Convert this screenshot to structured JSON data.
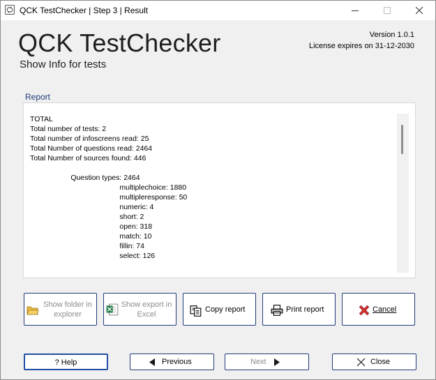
{
  "window": {
    "title": "QCK TestChecker | Step 3 | Result"
  },
  "header": {
    "app_title": "QCK TestChecker",
    "subtitle": "Show Info for tests",
    "version": "Version 1.0.1",
    "license": "License expires on 31-12-2030"
  },
  "report": {
    "label": "Report",
    "lines": [
      "TOTAL",
      "Total number of tests: 2",
      "Total number of infoscreens read: 25",
      "Total Number of questions read: 2464",
      "Total Number of sources found: 446",
      "",
      "                    Question types: 2464",
      "                                            multiplechoice: 1880",
      "                                            multipleresponse: 50",
      "                                            numeric: 4",
      "                                            short: 2",
      "                                            open: 318",
      "                                            match: 10",
      "                                            fillin: 74",
      "                                            select: 126"
    ]
  },
  "actions": {
    "show_folder_line1": "Show folder in",
    "show_folder_line2": "explorer",
    "show_export_line1": "Show export in",
    "show_export_line2": "Excel",
    "copy_report": "Copy report",
    "print_report": "Print report",
    "cancel": "Cancel"
  },
  "nav": {
    "help": "? Help",
    "previous": "Previous",
    "next": "Next",
    "close": "Close"
  },
  "colors": {
    "accent_border": "#1f3a7a",
    "cancel_red": "#d32f2f"
  },
  "icons": [
    "app-icon",
    "minimize-icon",
    "maximize-icon",
    "close-window-icon",
    "folder-icon",
    "excel-icon",
    "copy-icon",
    "printer-icon",
    "cancel-x-icon",
    "triangle-left-icon",
    "triangle-right-icon",
    "close-x-icon"
  ]
}
